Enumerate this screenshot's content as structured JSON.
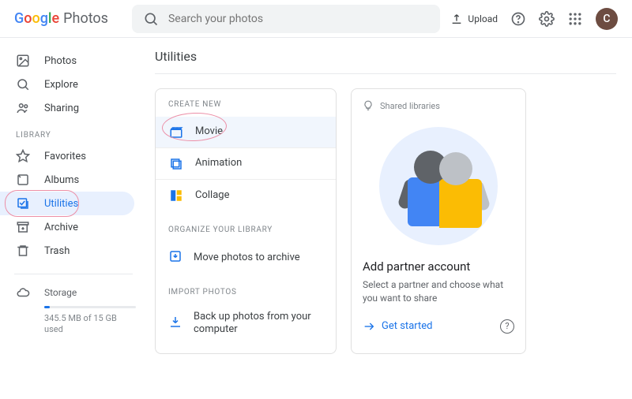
{
  "header": {
    "product": "Photos",
    "search_placeholder": "Search your photos",
    "upload": "Upload",
    "avatar_initial": "C"
  },
  "sidebar": {
    "photos": "Photos",
    "explore": "Explore",
    "sharing": "Sharing",
    "library_header": "LIBRARY",
    "favorites": "Favorites",
    "albums": "Albums",
    "utilities": "Utilities",
    "archive": "Archive",
    "trash": "Trash",
    "storage_label": "Storage",
    "storage_text": "345.5 MB of 15 GB used"
  },
  "main": {
    "title": "Utilities",
    "create_header": "CREATE NEW",
    "movie": "Movie",
    "animation": "Animation",
    "collage": "Collage",
    "organize_header": "ORGANIZE YOUR LIBRARY",
    "organize_item": "Move photos to archive",
    "import_header": "IMPORT PHOTOS",
    "import_item": "Back up photos from your computer"
  },
  "partner": {
    "header": "Shared libraries",
    "title": "Add partner account",
    "subtitle": "Select a partner and choose what you want to share",
    "cta": "Get started",
    "help": "?"
  }
}
